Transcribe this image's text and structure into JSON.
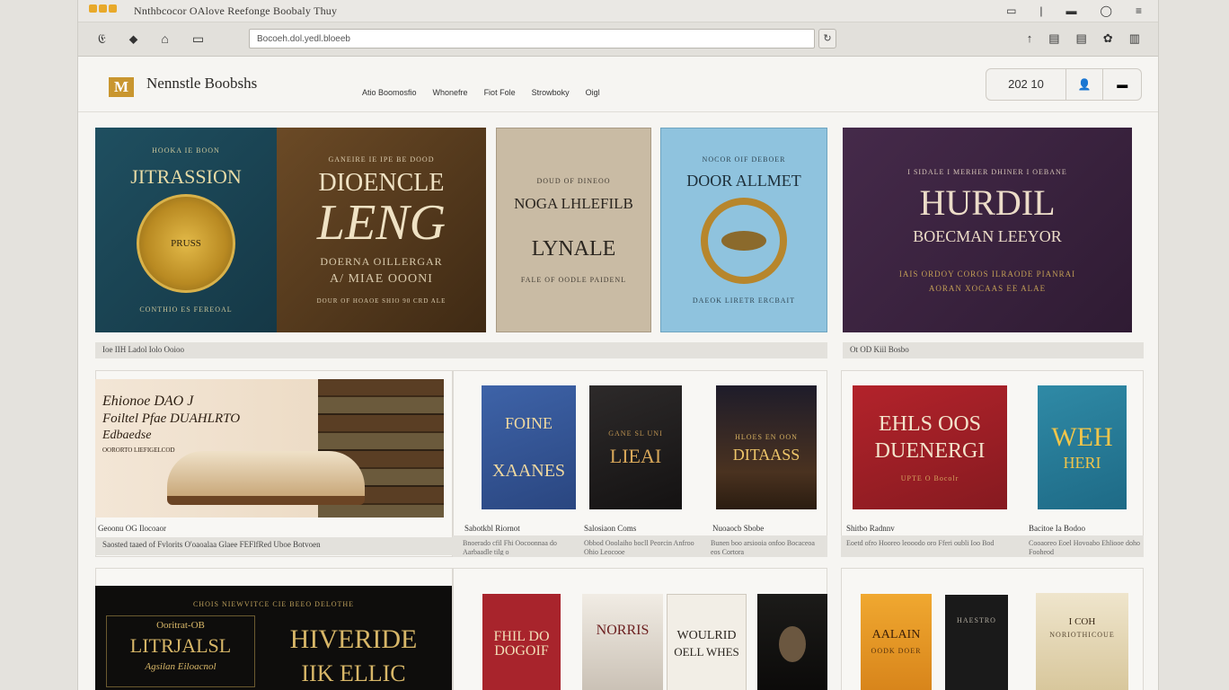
{
  "window": {
    "title": "Nnthbcocor OAlove Reefonge Boobaly Thuy",
    "title_icons": [
      "▭",
      "|",
      "▬",
      "◯",
      "≡"
    ]
  },
  "toolbar": {
    "left_icons": [
      "𝔈",
      "⬥",
      "⌂",
      "▭"
    ],
    "address": "Bocoeh.dol.yedl.bloeeb",
    "go": "↻",
    "right_icons": [
      "↑",
      "▤",
      "▤",
      "✿",
      "▥"
    ]
  },
  "site": {
    "logo": "M",
    "brand": "Nennstle Boobshs",
    "nav": [
      "Atio Boomosfio",
      "Whonefre",
      "Fiot Fole",
      "Strowboky",
      "Oigl"
    ],
    "account": {
      "count": "202  10",
      "user_icon": "👤",
      "menu_icon": "▬"
    }
  },
  "colors": {
    "accent": "#c9962f",
    "teal_cover": "#1b4a5a",
    "brown_cover": "#5b3d1f",
    "purple_cover": "#3d2440",
    "red_cover": "#a81e26"
  },
  "row1": {
    "covers": [
      {
        "top": "HOOKA IE BOON",
        "title": "JITRASSION",
        "sub": "CONTHIO ES FEREOAL",
        "seal": "PRUSS"
      },
      {
        "top": "GANEIRE IE IPE BE DOOD",
        "title": "DIOENCLE",
        "title2": "LENG",
        "sub": "DOERNA OILLERGAR",
        "sub2": "A/ MIAE OOONI",
        "foot": "DOUR OF HOAOE SHIO 90 CRD ALE"
      },
      {
        "top": "DOUD OF DINEOO",
        "title": "NOGA LHLEFILB",
        "title2": "LYNALE",
        "sub": "FALE OF OODLE PAIDENL"
      },
      {
        "top": "NOCOR OIF DEBOER",
        "title": "DOOR ALLMET",
        "sub": "DAEOK LIRETR ERCBAIT"
      },
      {
        "top": "I SIDALE I MERHER DHINER I OEBANE",
        "title": "HURDIL",
        "sub": "BOECMAN LEEYOR",
        "sub2": "IAIS ORDOY  COROS ILRAODE PIANRAI",
        "sub3": "AORAN XOCAAS EE ALAE"
      }
    ],
    "captions": [
      "Ioe  IIH    Ladol Iolo Ooioo",
      "Ot  OD  Kiil Bosbo"
    ]
  },
  "row2": {
    "feature": {
      "text": [
        "Ehionoe DAO J",
        "Foiltel Pfae DUAHLRTO",
        "Edbaedse"
      ],
      "sub": "OORORTO LIEFIGELCOD",
      "title": "Geoonu OG Ilocoaor",
      "desc": "Saosted taaed of Fvlorits O'oaoalaa Glaee FEFlfRed Uboe Botvoen"
    },
    "covers": [
      {
        "title": "FOINE",
        "title2": "XAANES"
      },
      {
        "title": "LIEAI",
        "top": "GANE SL UNI"
      },
      {
        "title": "DITAASS",
        "top": "HLOES EN OON"
      },
      {
        "title": "EHLS OOS",
        "title2": "DUENERGI",
        "sub": "UPTE O Bocolr"
      },
      {
        "title": "WEH",
        "title2": "HERI"
      }
    ],
    "labels": [
      "Sabotkbl Riornot",
      "Salosiaon Coms",
      "Nuoaocb Sbobe",
      "Shitbo Radnnv",
      "Bacitoe Ia Bodoo"
    ],
    "sublabels": [
      "Bnoerado cfil Fhi Oocoonnaa do Aarbaadle tilg o",
      "Obbod Ooolaiho bocll Peorcin Anfroo Ohio Leocooe",
      "Bunen boo arsiooia onfoo Bocaceoa eos Cortora",
      "Eoetd ofro Hooreo leooodo oro Fferi oubli Ioo Bod",
      "Cooaoreo Eoel Hovoabo Ehliooe doho Fooheod"
    ]
  },
  "row3": {
    "feature": {
      "top": "CHOIS NIEWVITCE CIE BEEO DELOTHE",
      "left_title": "LITRJALSL",
      "left_top": "Ooritrat-OB",
      "left_sub": "Agsilan Eiloacnol",
      "title": "HIVERIDE",
      "title2": "IIK ELLIC"
    },
    "covers": [
      {
        "title": "FHIL DO",
        "title2": "DOGOIF"
      },
      {
        "title": "NORRIS"
      },
      {
        "title": "WOULRID",
        "title2": "OELL WHES"
      },
      {
        "title": ""
      },
      {
        "title": "AALAIN",
        "sub": "OODK DOER"
      },
      {
        "title": "HAESTRO"
      },
      {
        "title": "I COH",
        "title2": "NORIOTHICOUE"
      }
    ]
  }
}
